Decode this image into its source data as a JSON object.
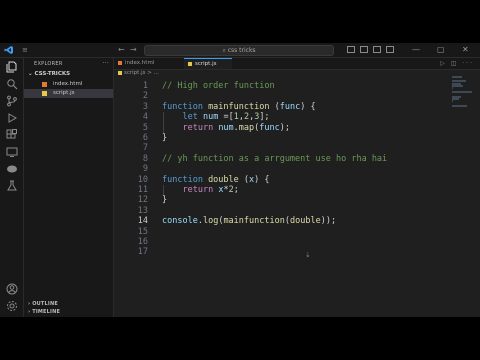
{
  "titlebar": {
    "search_text": "css tricks",
    "menu_dots": "≡",
    "back_glyph": "←",
    "forward_glyph": "→",
    "window_controls": [
      "—",
      "▢",
      "✕"
    ]
  },
  "activity_bar": {
    "icons": [
      "explorer-icon",
      "search-icon",
      "source-control-icon",
      "run-debug-icon",
      "extensions-icon",
      "remote-icon",
      "chat-icon",
      "testing-icon"
    ],
    "bottom_icons": [
      "account-icon",
      "settings-gear-icon"
    ]
  },
  "sidebar": {
    "header": "EXPLORER",
    "more": "···",
    "folder": "CSS-TRICKS",
    "files": [
      {
        "name": "index.html",
        "color": "#e37933",
        "active": false
      },
      {
        "name": "script.js",
        "color": "#e6c84a",
        "active": true
      }
    ],
    "sections": [
      "OUTLINE",
      "TIMELINE"
    ]
  },
  "tabs": [
    {
      "label": "index.html",
      "color": "#e37933",
      "active": false
    },
    {
      "label": "script.js",
      "color": "#e6c84a",
      "active": true
    }
  ],
  "tab_actions": "▷ ◫ ···",
  "breadcrumb": "script.js > ...",
  "editor": {
    "current_line": "14",
    "line_numbers": [
      "1",
      "2",
      "3",
      "4",
      "5",
      "6",
      "7",
      "8",
      "9",
      "10",
      "11",
      "12",
      "13",
      "14",
      "15",
      "16",
      "17"
    ],
    "lines": [
      {
        "tokens": [
          {
            "t": "// High order function",
            "c": "cm"
          }
        ]
      },
      {
        "tokens": []
      },
      {
        "tokens": [
          {
            "t": "function ",
            "c": "kw"
          },
          {
            "t": "mainfunction",
            "c": "fn"
          },
          {
            "t": " (",
            "c": ""
          },
          {
            "t": "func",
            "c": "var"
          },
          {
            "t": ") {",
            "c": ""
          }
        ]
      },
      {
        "tokens": [
          {
            "t": "    ",
            "c": ""
          },
          {
            "t": "let ",
            "c": "kw"
          },
          {
            "t": "num",
            "c": "var"
          },
          {
            "t": " =[",
            "c": ""
          },
          {
            "t": "1",
            "c": "num"
          },
          {
            "t": ",",
            "c": ""
          },
          {
            "t": "2",
            "c": "num"
          },
          {
            "t": ",",
            "c": ""
          },
          {
            "t": "3",
            "c": "num"
          },
          {
            "t": "];",
            "c": ""
          }
        ]
      },
      {
        "tokens": [
          {
            "t": "    ",
            "c": ""
          },
          {
            "t": "return ",
            "c": "ctl"
          },
          {
            "t": "num",
            "c": "var"
          },
          {
            "t": ".",
            "c": ""
          },
          {
            "t": "map",
            "c": "fn"
          },
          {
            "t": "(",
            "c": ""
          },
          {
            "t": "func",
            "c": "var"
          },
          {
            "t": ");",
            "c": ""
          }
        ]
      },
      {
        "tokens": [
          {
            "t": "}",
            "c": ""
          }
        ]
      },
      {
        "tokens": []
      },
      {
        "tokens": [
          {
            "t": "// yh function as a arrgument use ho rha hai",
            "c": "cm"
          }
        ]
      },
      {
        "tokens": []
      },
      {
        "tokens": [
          {
            "t": "function ",
            "c": "kw"
          },
          {
            "t": "double",
            "c": "fn"
          },
          {
            "t": " (",
            "c": ""
          },
          {
            "t": "x",
            "c": "var"
          },
          {
            "t": ") {",
            "c": ""
          }
        ]
      },
      {
        "tokens": [
          {
            "t": "    ",
            "c": ""
          },
          {
            "t": "return ",
            "c": "ctl"
          },
          {
            "t": "x",
            "c": "var"
          },
          {
            "t": "*",
            "c": ""
          },
          {
            "t": "2",
            "c": "num"
          },
          {
            "t": ";",
            "c": ""
          }
        ]
      },
      {
        "tokens": [
          {
            "t": "}",
            "c": ""
          }
        ]
      },
      {
        "tokens": []
      },
      {
        "tokens": [
          {
            "t": "console",
            "c": "var"
          },
          {
            "t": ".",
            "c": ""
          },
          {
            "t": "log",
            "c": "fn"
          },
          {
            "t": "(",
            "c": ""
          },
          {
            "t": "mainfunction",
            "c": "fn"
          },
          {
            "t": "(",
            "c": ""
          },
          {
            "t": "double",
            "c": "fn"
          },
          {
            "t": "));",
            "c": ""
          }
        ]
      },
      {
        "tokens": []
      },
      {
        "tokens": []
      },
      {
        "tokens": []
      }
    ]
  },
  "colors": {
    "accent": "#3c9cf0",
    "editor_bg": "#1f1f1f",
    "sidebar_bg": "#181818",
    "keyword": "#569cd6",
    "function": "#dcdcaa",
    "comment": "#6a9955"
  }
}
